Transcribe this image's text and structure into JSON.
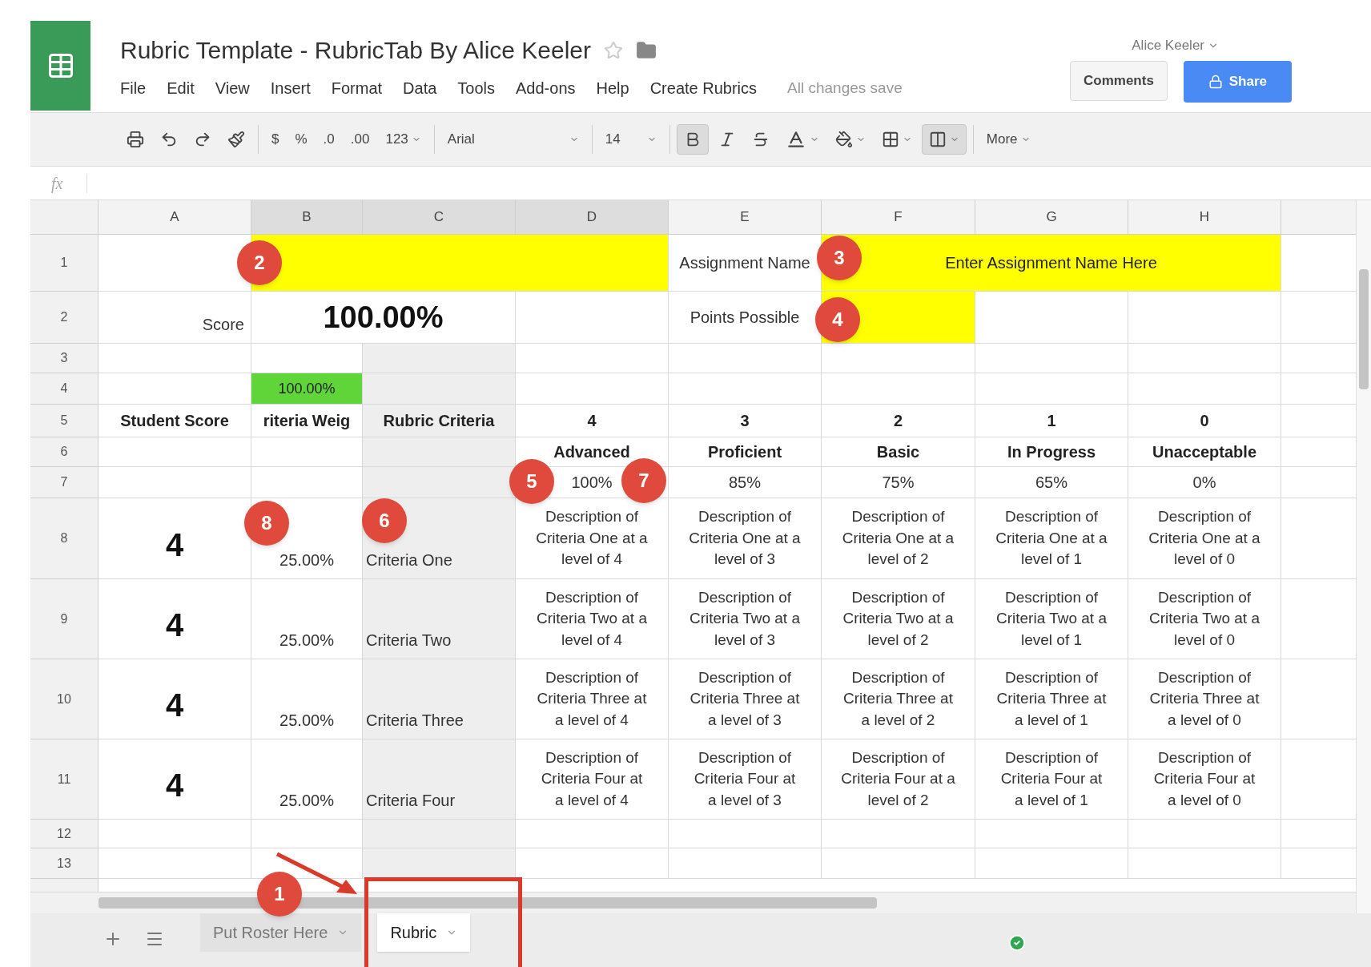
{
  "app": {
    "title": "Rubric Template - RubricTab By Alice Keeler",
    "account": "Alice Keeler",
    "save_status": "All changes save",
    "comments_button": "Comments",
    "share_button": "Share"
  },
  "menus": [
    "File",
    "Edit",
    "View",
    "Insert",
    "Format",
    "Data",
    "Tools",
    "Add-ons",
    "Help",
    "Create Rubrics"
  ],
  "toolbar": {
    "currency": "$",
    "percent": "%",
    "decrease_decimals": ".0",
    "increase_decimals": ".00",
    "number_format": "123",
    "font": "Arial",
    "font_size": "14",
    "more": "More",
    "bold_pressed": true,
    "merge_pressed": true
  },
  "formula_bar": {
    "label": "fx"
  },
  "columns": [
    {
      "label": "A",
      "selected": false
    },
    {
      "label": "B",
      "selected": true
    },
    {
      "label": "C",
      "selected": true
    },
    {
      "label": "D",
      "selected": true
    },
    {
      "label": "E",
      "selected": false
    },
    {
      "label": "F",
      "selected": false
    },
    {
      "label": "G",
      "selected": false
    },
    {
      "label": "H",
      "selected": false
    }
  ],
  "rows": [
    {
      "number": "1",
      "cells": [
        {
          "kind": "blank"
        },
        {
          "kind": "merged_input"
        },
        {
          "kind": "label",
          "text": "Assignment Name"
        },
        {
          "kind": "merged_input",
          "text": "Enter Assignment Name Here"
        }
      ]
    },
    {
      "number": "2",
      "cells": [
        {
          "kind": "right",
          "text": "Score"
        },
        {
          "kind": "big",
          "text": "100.00%"
        },
        {
          "kind": "blank"
        },
        {
          "kind": "label",
          "text": "Points Possible"
        },
        {
          "kind": "input"
        },
        {
          "kind": "blank"
        },
        {
          "kind": "blank"
        }
      ]
    },
    {
      "number": "3",
      "cells": [
        {
          "kind": "blank"
        },
        {
          "kind": "blank"
        },
        {
          "kind": "blank",
          "shaded": true
        },
        {
          "kind": "blank"
        },
        {
          "kind": "blank"
        },
        {
          "kind": "blank"
        },
        {
          "kind": "blank"
        },
        {
          "kind": "blank"
        }
      ]
    },
    {
      "number": "4",
      "cells": [
        {
          "kind": "blank"
        },
        {
          "kind": "meter",
          "text": "100.00%"
        },
        {
          "kind": "blank",
          "shaded": true
        },
        {
          "kind": "blank"
        },
        {
          "kind": "blank"
        },
        {
          "kind": "blank"
        },
        {
          "kind": "blank"
        },
        {
          "kind": "blank"
        }
      ]
    },
    {
      "number": "5",
      "cells": [
        {
          "kind": "header",
          "text": "Student Score"
        },
        {
          "kind": "header",
          "text": "riteria Weig"
        },
        {
          "kind": "header",
          "text": "Rubric Criteria",
          "shaded": true
        },
        {
          "kind": "header",
          "text": "4"
        },
        {
          "kind": "header",
          "text": "3"
        },
        {
          "kind": "header",
          "text": "2"
        },
        {
          "kind": "header",
          "text": "1"
        },
        {
          "kind": "header",
          "text": "0"
        }
      ]
    },
    {
      "number": "6",
      "cells": [
        {
          "kind": "blank"
        },
        {
          "kind": "blank"
        },
        {
          "kind": "blank",
          "shaded": true
        },
        {
          "kind": "header",
          "text": "Advanced"
        },
        {
          "kind": "header",
          "text": "Proficient"
        },
        {
          "kind": "header",
          "text": "Basic"
        },
        {
          "kind": "header",
          "text": "In Progress"
        },
        {
          "kind": "header",
          "text": "Unacceptable"
        }
      ]
    },
    {
      "number": "7",
      "cells": [
        {
          "kind": "blank"
        },
        {
          "kind": "blank"
        },
        {
          "kind": "blank",
          "shaded": true
        },
        {
          "kind": "center",
          "text": "100%"
        },
        {
          "kind": "center",
          "text": "85%"
        },
        {
          "kind": "center",
          "text": "75%"
        },
        {
          "kind": "center",
          "text": "65%"
        },
        {
          "kind": "center",
          "text": "0%"
        }
      ]
    },
    {
      "number": "8",
      "cells": [
        {
          "kind": "score",
          "text": "4"
        },
        {
          "kind": "weight",
          "text": "25.00%"
        },
        {
          "kind": "criteria",
          "text": "Criteria One",
          "shaded": true
        },
        {
          "kind": "description",
          "text": "Description of Criteria One at a level of 4"
        },
        {
          "kind": "description",
          "text": "Description of Criteria One at a level of 3"
        },
        {
          "kind": "description",
          "text": "Description of Criteria One at a level of 2"
        },
        {
          "kind": "description",
          "text": "Description of Criteria One at a level of 1"
        },
        {
          "kind": "description",
          "text": "Description of Criteria One at a level of 0"
        }
      ]
    },
    {
      "number": "9",
      "cells": [
        {
          "kind": "score",
          "text": "4"
        },
        {
          "kind": "weight",
          "text": "25.00%"
        },
        {
          "kind": "criteria",
          "text": "Criteria Two",
          "shaded": true
        },
        {
          "kind": "description",
          "text": "Description of Criteria Two at a level of 4"
        },
        {
          "kind": "description",
          "text": "Description of Criteria Two at a level of 3"
        },
        {
          "kind": "description",
          "text": "Description of Criteria Two at a level of 2"
        },
        {
          "kind": "description",
          "text": "Description of Criteria Two at a level of 1"
        },
        {
          "kind": "description",
          "text": "Description of Criteria Two at a level of 0"
        }
      ]
    },
    {
      "number": "10",
      "cells": [
        {
          "kind": "score",
          "text": "4"
        },
        {
          "kind": "weight",
          "text": "25.00%"
        },
        {
          "kind": "criteria",
          "text": "Criteria Three",
          "shaded": true
        },
        {
          "kind": "description",
          "text": "Description of Criteria Three at a level of 4"
        },
        {
          "kind": "description",
          "text": "Description of Criteria Three at a level of 3"
        },
        {
          "kind": "description",
          "text": "Description of Criteria Three at a level of 2"
        },
        {
          "kind": "description",
          "text": "Description of Criteria Three at a level of 1"
        },
        {
          "kind": "description",
          "text": "Description of Criteria Three at a level of 0"
        }
      ]
    },
    {
      "number": "11",
      "cells": [
        {
          "kind": "score",
          "text": "4"
        },
        {
          "kind": "weight",
          "text": "25.00%"
        },
        {
          "kind": "criteria",
          "text": "Criteria Four",
          "shaded": true
        },
        {
          "kind": "description",
          "text": "Description of Criteria Four at a level of 4"
        },
        {
          "kind": "description",
          "text": "Description of Criteria Four at a level of 3"
        },
        {
          "kind": "description",
          "text": "Description of Criteria Four at a level of 2"
        },
        {
          "kind": "description",
          "text": "Description of Criteria Four at a level of 1"
        },
        {
          "kind": "description",
          "text": "Description of Criteria Four at a level of 0"
        }
      ]
    },
    {
      "number": "12",
      "cells": [
        {
          "kind": "blank"
        },
        {
          "kind": "blank"
        },
        {
          "kind": "blank",
          "shaded": true
        },
        {
          "kind": "blank"
        },
        {
          "kind": "blank"
        },
        {
          "kind": "blank"
        },
        {
          "kind": "blank"
        },
        {
          "kind": "blank"
        }
      ]
    },
    {
      "number": "13",
      "cells": [
        {
          "kind": "blank"
        },
        {
          "kind": "blank"
        },
        {
          "kind": "blank",
          "shaded": true
        },
        {
          "kind": "blank"
        },
        {
          "kind": "blank"
        },
        {
          "kind": "blank"
        },
        {
          "kind": "blank"
        },
        {
          "kind": "blank"
        }
      ]
    }
  ],
  "sheet_tabs": [
    {
      "label": "Put Roster Here",
      "selected": false
    },
    {
      "label": "Rubric",
      "selected": true
    }
  ],
  "badges": [
    "1",
    "2",
    "3",
    "4",
    "5",
    "6",
    "7",
    "8"
  ]
}
